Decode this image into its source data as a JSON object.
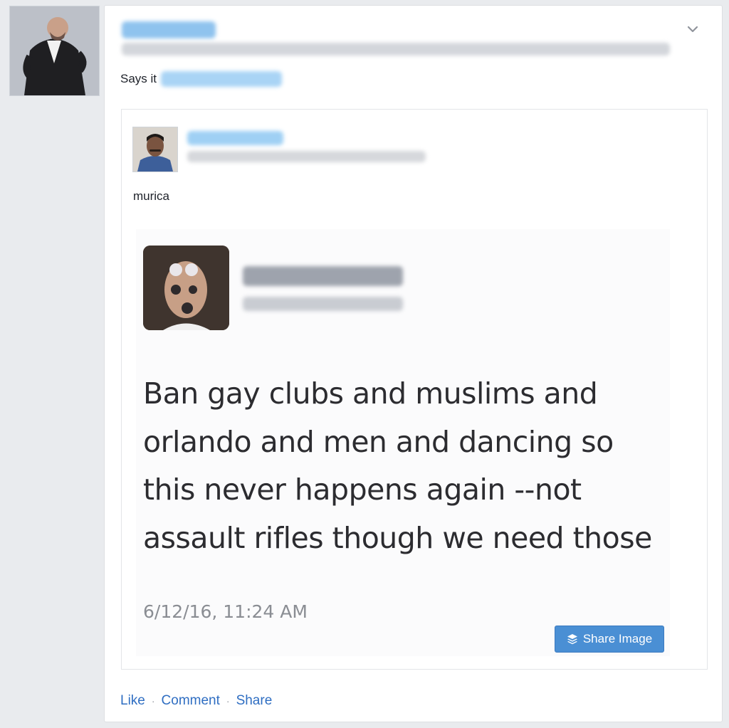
{
  "post": {
    "says_prefix": "Says it",
    "shared_caption": "murica",
    "tweet": {
      "text": "Ban gay clubs and muslims and orlando and men and dancing so this never happens again --not assault rifles though we need those",
      "timestamp": "6/12/16, 11:24 AM",
      "share_image_label": "Share Image",
      "share_icon": "layers-icon"
    },
    "actions": {
      "like": "Like",
      "comment": "Comment",
      "share": "Share",
      "separator": "·"
    },
    "menu_icon": "chevron-down-icon"
  },
  "colors": {
    "link": "#2f6ec2",
    "button": "#4a8fd4",
    "background": "#e9ebee"
  }
}
